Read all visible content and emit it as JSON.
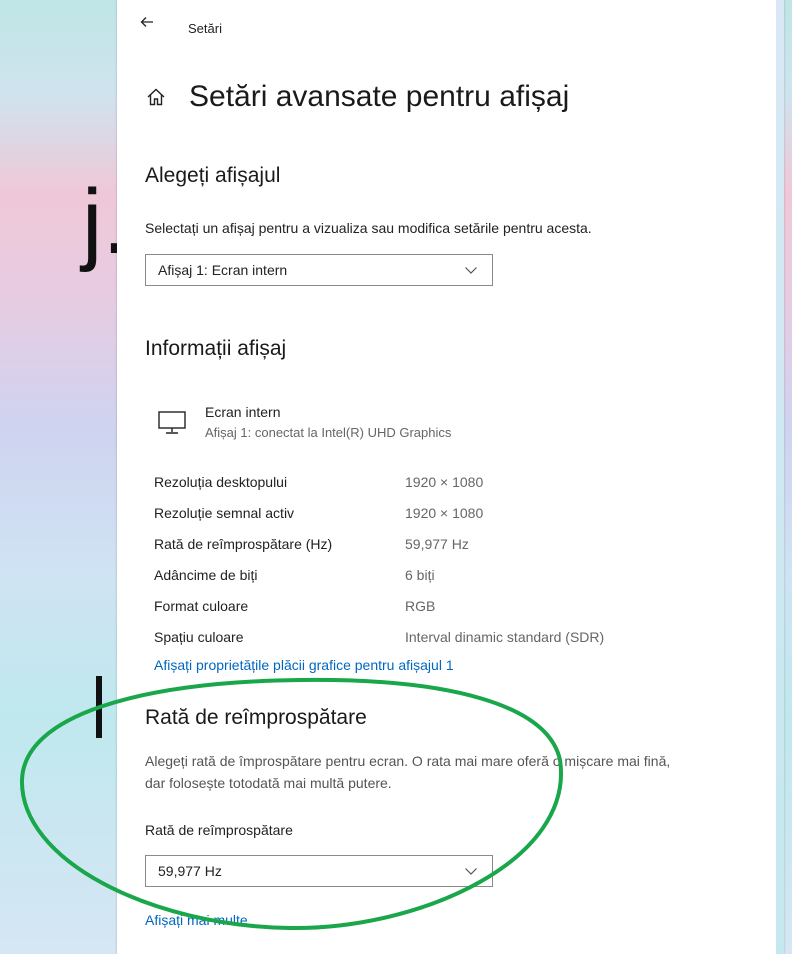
{
  "app": {
    "title": "Setări"
  },
  "header": {
    "title": "Setări avansate pentru afișaj"
  },
  "choose_display": {
    "heading": "Alegeți afișajul",
    "description": "Selectați un afișaj pentru a vizualiza sau modifica setările pentru acesta.",
    "selected": "Afișaj 1: Ecran intern"
  },
  "display_info": {
    "heading": "Informații afișaj",
    "monitor_name": "Ecran intern",
    "monitor_detail": "Afișaj 1: conectat la Intel(R) UHD Graphics",
    "rows": [
      {
        "key": "Rezoluția desktopului",
        "value": "1920 × 1080"
      },
      {
        "key": "Rezoluție semnal activ",
        "value": "1920 × 1080"
      },
      {
        "key": "Rată de reîmprospătare (Hz)",
        "value": "59,977 Hz"
      },
      {
        "key": "Adâncime de biți",
        "value": "6 biți"
      },
      {
        "key": "Format culoare",
        "value": "RGB"
      },
      {
        "key": "Spațiu culoare",
        "value": "Interval dinamic standard (SDR)"
      }
    ],
    "adapter_link": "Afișați proprietățile plăcii grafice pentru afișajul 1"
  },
  "refresh": {
    "heading": "Rată de reîmprospătare",
    "description": "Alegeți rată de împrospătare pentru ecran. O rata mai mare oferă o mișcare mai fină, dar folosește totodată mai multă putere.",
    "field_label": "Rată de reîmprospătare",
    "selected": "59,977 Hz",
    "more_link": "Afișați mai multe"
  },
  "background": {
    "glyph": "j."
  },
  "colors": {
    "link": "#0067c0",
    "annotation": "#1aa64a"
  }
}
